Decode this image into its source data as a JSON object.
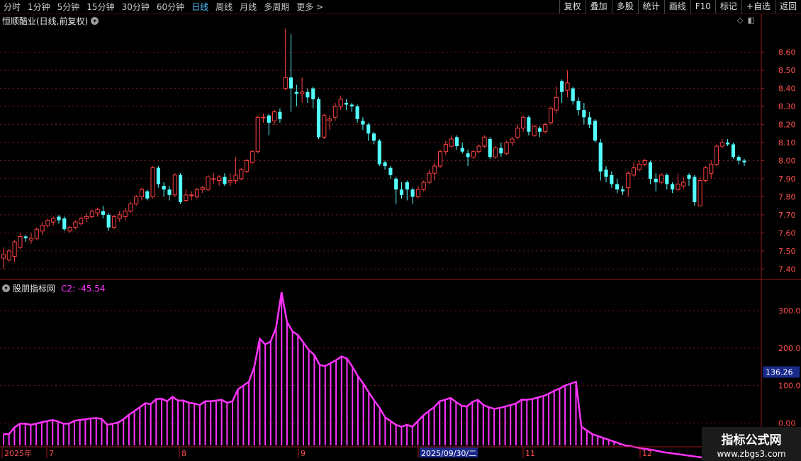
{
  "toolbar": {
    "timeframes": [
      "分时",
      "1分钟",
      "5分钟",
      "15分钟",
      "30分钟",
      "60分钟",
      "日线",
      "周线",
      "月线",
      "多周期",
      "更多 >"
    ],
    "active_timeframe": "日线",
    "right_buttons": [
      "复权",
      "叠加",
      "多股",
      "统计",
      "画线",
      "F10",
      "标记",
      "+自选",
      "返回"
    ]
  },
  "chart_title": "恒顺醋业(日线,前复权)",
  "indicator": {
    "name": "股朋指标网",
    "value_label": "C2: -45.54"
  },
  "price_axis": {
    "ticks": [
      "8.60",
      "8.50",
      "8.40",
      "8.30",
      "8.20",
      "8.10",
      "8.00",
      "7.90",
      "7.80",
      "7.70",
      "7.60",
      "7.50",
      "7.40"
    ]
  },
  "indicator_axis": {
    "ticks": [
      "300.0",
      "200.0",
      "100.0",
      "0.00"
    ],
    "current_value": "136.26"
  },
  "date_axis": {
    "labels": [
      "2025年",
      "7",
      "8",
      "9",
      "2025/09/30/二",
      "11",
      "12"
    ]
  },
  "watermark": {
    "title": "指标公式网",
    "url": "www.zbgs3.com"
  },
  "colors": {
    "up": "#ff4040",
    "down": "#54ffff",
    "indicator": "#ff33ff",
    "grid": "#7a1a1a",
    "axis": "#a01818"
  },
  "chart_data": {
    "type": "candlestick",
    "ohlc": [
      [
        7.46,
        7.48,
        7.4,
        7.52
      ],
      [
        7.45,
        7.5,
        7.44,
        7.51
      ],
      [
        7.47,
        7.55,
        7.44,
        7.56
      ],
      [
        7.52,
        7.58,
        7.51,
        7.6
      ],
      [
        7.58,
        7.57,
        7.55,
        7.59
      ],
      [
        7.56,
        7.57,
        7.54,
        7.6
      ],
      [
        7.57,
        7.62,
        7.56,
        7.63
      ],
      [
        7.61,
        7.64,
        7.59,
        7.66
      ],
      [
        7.64,
        7.67,
        7.63,
        7.68
      ],
      [
        7.66,
        7.68,
        7.64,
        7.69
      ],
      [
        7.69,
        7.67,
        7.65,
        7.7
      ],
      [
        7.68,
        7.62,
        7.61,
        7.69
      ],
      [
        7.61,
        7.63,
        7.6,
        7.64
      ],
      [
        7.63,
        7.66,
        7.62,
        7.67
      ],
      [
        7.65,
        7.68,
        7.64,
        7.69
      ],
      [
        7.68,
        7.69,
        7.66,
        7.71
      ],
      [
        7.69,
        7.72,
        7.68,
        7.73
      ],
      [
        7.71,
        7.73,
        7.69,
        7.74
      ],
      [
        7.72,
        7.7,
        7.68,
        7.75
      ],
      [
        7.7,
        7.63,
        7.61,
        7.71
      ],
      [
        7.63,
        7.69,
        7.62,
        7.7
      ],
      [
        7.68,
        7.7,
        7.66,
        7.72
      ],
      [
        7.69,
        7.72,
        7.67,
        7.74
      ],
      [
        7.72,
        7.76,
        7.71,
        7.77
      ],
      [
        7.76,
        7.8,
        7.75,
        7.81
      ],
      [
        7.8,
        7.84,
        7.78,
        7.85
      ],
      [
        7.83,
        7.79,
        7.78,
        7.84
      ],
      [
        7.8,
        7.96,
        7.79,
        7.97
      ],
      [
        7.96,
        7.87,
        7.85,
        7.97
      ],
      [
        7.86,
        7.84,
        7.8,
        7.88
      ],
      [
        7.84,
        7.81,
        7.78,
        7.86
      ],
      [
        7.81,
        7.92,
        7.8,
        7.93
      ],
      [
        7.92,
        7.77,
        7.76,
        7.93
      ],
      [
        7.78,
        7.81,
        7.77,
        7.84
      ],
      [
        7.81,
        7.81,
        7.78,
        7.83
      ],
      [
        7.8,
        7.84,
        7.79,
        7.85
      ],
      [
        7.84,
        7.85,
        7.82,
        7.86
      ],
      [
        7.84,
        7.91,
        7.83,
        7.92
      ],
      [
        7.9,
        7.9,
        7.87,
        7.93
      ],
      [
        7.89,
        7.91,
        7.86,
        7.92
      ],
      [
        7.91,
        7.87,
        7.86,
        7.93
      ],
      [
        7.88,
        7.89,
        7.86,
        7.93
      ],
      [
        7.89,
        7.92,
        7.87,
        8.02
      ],
      [
        7.9,
        7.95,
        7.89,
        7.96
      ],
      [
        7.94,
        8.0,
        7.93,
        8.01
      ],
      [
        7.99,
        8.05,
        7.98,
        8.06
      ],
      [
        8.05,
        8.24,
        8.04,
        8.25
      ],
      [
        8.24,
        8.24,
        8.21,
        8.26
      ],
      [
        8.25,
        8.21,
        8.14,
        8.26
      ],
      [
        8.22,
        8.27,
        8.2,
        8.28
      ],
      [
        8.27,
        8.23,
        8.21,
        8.29
      ],
      [
        8.4,
        8.46,
        8.39,
        8.73
      ],
      [
        8.46,
        8.4,
        8.27,
        8.7
      ],
      [
        8.38,
        8.37,
        8.3,
        8.42
      ],
      [
        8.37,
        8.38,
        8.32,
        8.46
      ],
      [
        8.38,
        8.35,
        8.32,
        8.4
      ],
      [
        8.4,
        8.34,
        8.29,
        8.41
      ],
      [
        8.34,
        8.13,
        8.12,
        8.35
      ],
      [
        8.13,
        8.25,
        8.12,
        8.26
      ],
      [
        8.22,
        8.23,
        8.17,
        8.25
      ],
      [
        8.24,
        8.3,
        8.22,
        8.32
      ],
      [
        8.3,
        8.34,
        8.28,
        8.36
      ],
      [
        8.32,
        8.31,
        8.28,
        8.34
      ],
      [
        8.31,
        8.3,
        8.27,
        8.32
      ],
      [
        8.3,
        8.23,
        8.21,
        8.31
      ],
      [
        8.22,
        8.2,
        8.17,
        8.24
      ],
      [
        8.2,
        8.15,
        8.11,
        8.21
      ],
      [
        8.15,
        8.11,
        8.09,
        8.16
      ],
      [
        8.11,
        7.98,
        7.97,
        8.12
      ],
      [
        7.99,
        7.97,
        7.95,
        8.0
      ],
      [
        7.96,
        7.92,
        7.9,
        7.97
      ],
      [
        7.9,
        7.84,
        7.76,
        7.91
      ],
      [
        7.84,
        7.81,
        7.79,
        7.88
      ],
      [
        7.88,
        7.84,
        7.78,
        7.89
      ],
      [
        7.84,
        7.8,
        7.76,
        7.85
      ],
      [
        7.8,
        7.84,
        7.79,
        7.86
      ],
      [
        7.84,
        7.88,
        7.83,
        7.89
      ],
      [
        7.88,
        7.93,
        7.87,
        7.95
      ],
      [
        7.93,
        7.97,
        7.89,
        7.99
      ],
      [
        7.97,
        8.05,
        7.96,
        8.06
      ],
      [
        8.05,
        8.09,
        8.03,
        8.11
      ],
      [
        8.08,
        8.12,
        8.07,
        8.14
      ],
      [
        8.13,
        8.08,
        8.06,
        8.14
      ],
      [
        8.07,
        8.05,
        8.04,
        8.1
      ],
      [
        8.04,
        8.02,
        7.97,
        8.06
      ],
      [
        8.02,
        8.05,
        8.01,
        8.06
      ],
      [
        8.05,
        8.08,
        8.04,
        8.09
      ],
      [
        8.08,
        8.13,
        8.07,
        8.14
      ],
      [
        8.12,
        8.02,
        8.01,
        8.13
      ],
      [
        8.02,
        8.07,
        8.01,
        8.08
      ],
      [
        8.07,
        8.04,
        8.02,
        8.1
      ],
      [
        8.04,
        8.1,
        8.03,
        8.11
      ],
      [
        8.1,
        8.12,
        8.08,
        8.13
      ],
      [
        8.13,
        8.18,
        8.12,
        8.2
      ],
      [
        8.18,
        8.24,
        8.16,
        8.25
      ],
      [
        8.24,
        8.16,
        8.14,
        8.25
      ],
      [
        8.14,
        8.19,
        8.13,
        8.2
      ],
      [
        8.18,
        8.16,
        8.13,
        8.19
      ],
      [
        8.16,
        8.2,
        8.15,
        8.21
      ],
      [
        8.21,
        8.29,
        8.2,
        8.3
      ],
      [
        8.28,
        8.35,
        8.26,
        8.41
      ],
      [
        8.44,
        8.38,
        8.32,
        8.45
      ],
      [
        8.39,
        8.43,
        8.35,
        8.5
      ],
      [
        8.4,
        8.33,
        8.31,
        8.41
      ],
      [
        8.33,
        8.28,
        8.25,
        8.35
      ],
      [
        8.28,
        8.24,
        8.2,
        8.32
      ],
      [
        8.24,
        8.2,
        8.18,
        8.27
      ],
      [
        8.22,
        8.11,
        8.1,
        8.23
      ],
      [
        8.1,
        7.94,
        7.89,
        8.12
      ],
      [
        7.95,
        7.91,
        7.88,
        7.97
      ],
      [
        7.92,
        7.87,
        7.85,
        7.94
      ],
      [
        7.87,
        7.84,
        7.82,
        7.9
      ],
      [
        7.84,
        7.83,
        7.81,
        7.86
      ],
      [
        7.85,
        7.93,
        7.8,
        7.94
      ],
      [
        7.92,
        7.96,
        7.91,
        7.99
      ],
      [
        7.95,
        7.98,
        7.94,
        8.0
      ],
      [
        7.98,
        8.0,
        7.97,
        8.01
      ],
      [
        7.99,
        7.9,
        7.87,
        8.0
      ],
      [
        7.9,
        7.88,
        7.83,
        7.93
      ],
      [
        7.88,
        7.92,
        7.87,
        7.93
      ],
      [
        7.92,
        7.87,
        7.84,
        7.93
      ],
      [
        7.87,
        7.84,
        7.82,
        7.88
      ],
      [
        7.84,
        7.87,
        7.83,
        7.93
      ],
      [
        7.86,
        7.88,
        7.84,
        7.91
      ],
      [
        7.92,
        7.9,
        7.86,
        7.93
      ],
      [
        7.91,
        7.77,
        7.75,
        7.92
      ],
      [
        7.75,
        7.89,
        7.75,
        7.91
      ],
      [
        7.89,
        7.96,
        7.88,
        7.97
      ],
      [
        7.93,
        7.98,
        7.9,
        8.0
      ],
      [
        7.98,
        8.08,
        7.97,
        8.09
      ],
      [
        8.08,
        8.1,
        8.07,
        8.12
      ],
      [
        8.1,
        8.09,
        8.08,
        8.12
      ],
      [
        8.09,
        8.02,
        8.01,
        8.1
      ],
      [
        8.02,
        8.0,
        7.98,
        8.03
      ],
      [
        8.0,
        7.99,
        7.97,
        8.01
      ]
    ],
    "indicator_values": [
      -30,
      -30,
      -12,
      -2,
      -2,
      -5,
      -2,
      2,
      5,
      8,
      4,
      -2,
      -2,
      6,
      8,
      10,
      12,
      13,
      11,
      -5,
      -2,
      1,
      10,
      22,
      32,
      42,
      53,
      50,
      64,
      65,
      58,
      70,
      60,
      60,
      54,
      52,
      48,
      58,
      58,
      60,
      62,
      54,
      58,
      90,
      100,
      110,
      150,
      225,
      210,
      218,
      255,
      350,
      270,
      245,
      235,
      215,
      195,
      182,
      155,
      152,
      160,
      168,
      178,
      172,
      150,
      125,
      105,
      82,
      60,
      40,
      15,
      5,
      -5,
      -10,
      -5,
      -10,
      5,
      20,
      32,
      42,
      58,
      62,
      67,
      56,
      46,
      44,
      56,
      62,
      48,
      42,
      38,
      40,
      44,
      48,
      52,
      62,
      62,
      64,
      68,
      72,
      78,
      86,
      92,
      100,
      105,
      110,
      -10,
      -20,
      -30,
      -35,
      -40,
      -45,
      -50,
      -55,
      -60,
      -62,
      -65,
      -68,
      -70,
      -72,
      -75,
      -78,
      -80,
      -82,
      -84,
      -86,
      -88,
      -90,
      -92,
      -94,
      -96,
      -98,
      -99,
      -100,
      -100,
      -100,
      -100,
      -100,
      -100,
      -100
    ],
    "indicator_shape": [
      -30,
      -30,
      -12,
      -2,
      -2,
      -5,
      -2,
      2,
      5,
      8,
      4,
      -2,
      -2,
      6,
      8,
      10,
      12,
      13,
      11,
      -5,
      -2,
      1,
      10,
      22,
      32,
      42,
      53,
      50,
      64,
      65,
      58,
      70,
      60,
      60,
      54,
      52,
      48,
      58,
      58,
      60,
      62,
      54,
      58,
      90,
      100,
      110,
      150,
      225,
      210,
      218,
      255,
      350,
      270,
      245,
      235,
      215,
      195,
      182,
      155,
      152,
      160,
      168,
      178,
      172,
      150,
      125,
      105,
      82,
      60,
      40,
      15,
      5,
      -5,
      -10,
      -5,
      -10,
      5,
      20,
      32,
      42,
      58,
      62,
      67,
      56,
      46,
      44,
      56,
      62,
      48,
      42,
      38,
      40,
      44,
      48,
      52,
      62,
      62,
      64,
      68,
      72,
      78,
      86,
      92,
      100,
      105,
      110,
      -10,
      -20,
      -30,
      -35,
      -40,
      -45,
      -50,
      -55,
      -60,
      -62,
      -65,
      -68,
      -70,
      -72,
      -75,
      -78,
      -80,
      -82,
      -84,
      -86,
      -88,
      -90,
      -92,
      -94,
      -96,
      -98,
      -99,
      -100,
      -100,
      -100,
      -100,
      -100,
      -100,
      -100
    ]
  }
}
